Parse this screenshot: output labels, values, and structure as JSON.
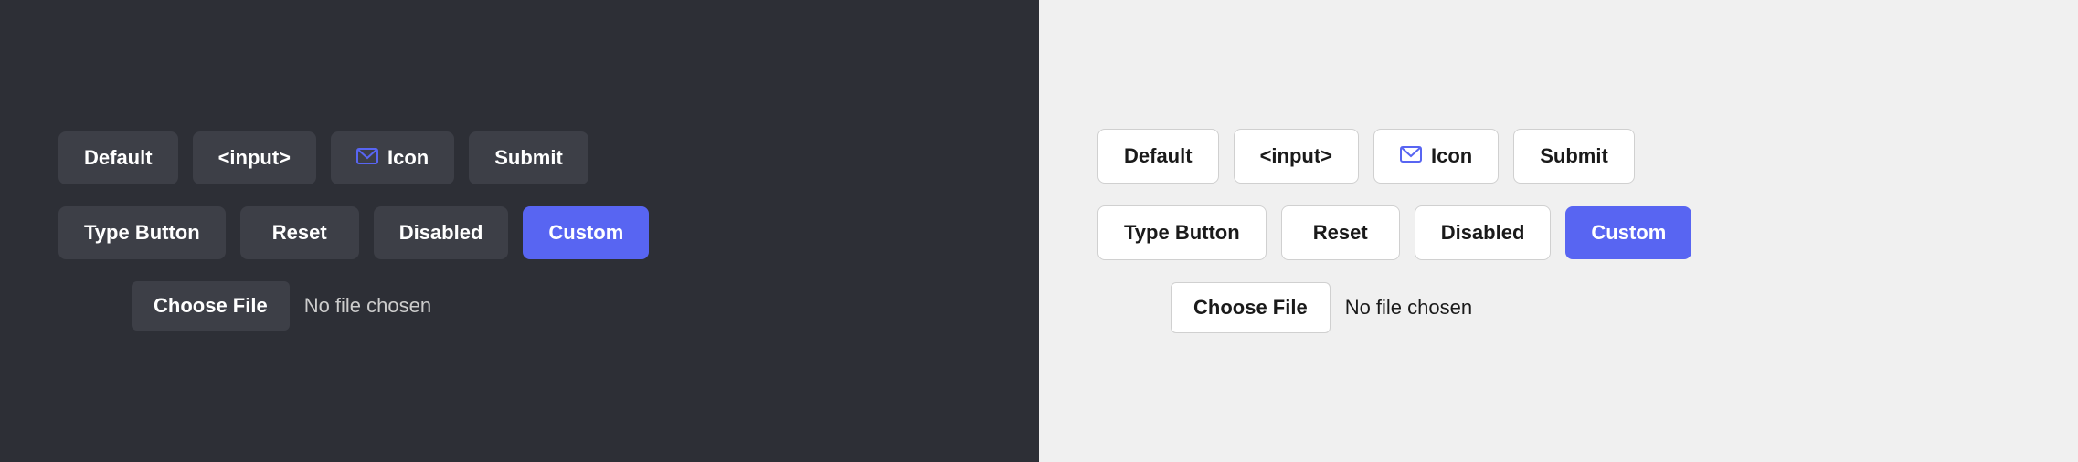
{
  "dark_panel": {
    "bg_color": "#2d2f36",
    "row1": {
      "buttons": [
        {
          "label": "Default",
          "type": "default"
        },
        {
          "label": "<input>",
          "type": "default"
        },
        {
          "label": "Icon",
          "type": "icon"
        },
        {
          "label": "Submit",
          "type": "default"
        }
      ]
    },
    "row2": {
      "buttons": [
        {
          "label": "Type Button",
          "type": "default"
        },
        {
          "label": "Reset",
          "type": "default"
        },
        {
          "label": "Disabled",
          "type": "default"
        },
        {
          "label": "Custom",
          "type": "custom"
        }
      ]
    },
    "file": {
      "button_label": "Choose File",
      "status": "No file chosen"
    }
  },
  "light_panel": {
    "bg_color": "#f0f0f0",
    "row1": {
      "buttons": [
        {
          "label": "Default",
          "type": "default"
        },
        {
          "label": "<input>",
          "type": "default"
        },
        {
          "label": "Icon",
          "type": "icon"
        },
        {
          "label": "Submit",
          "type": "default"
        }
      ]
    },
    "row2": {
      "buttons": [
        {
          "label": "Type Button",
          "type": "default"
        },
        {
          "label": "Reset",
          "type": "default"
        },
        {
          "label": "Disabled",
          "type": "default"
        },
        {
          "label": "Custom",
          "type": "custom"
        }
      ]
    },
    "file": {
      "button_label": "Choose File",
      "status": "No file chosen"
    }
  }
}
